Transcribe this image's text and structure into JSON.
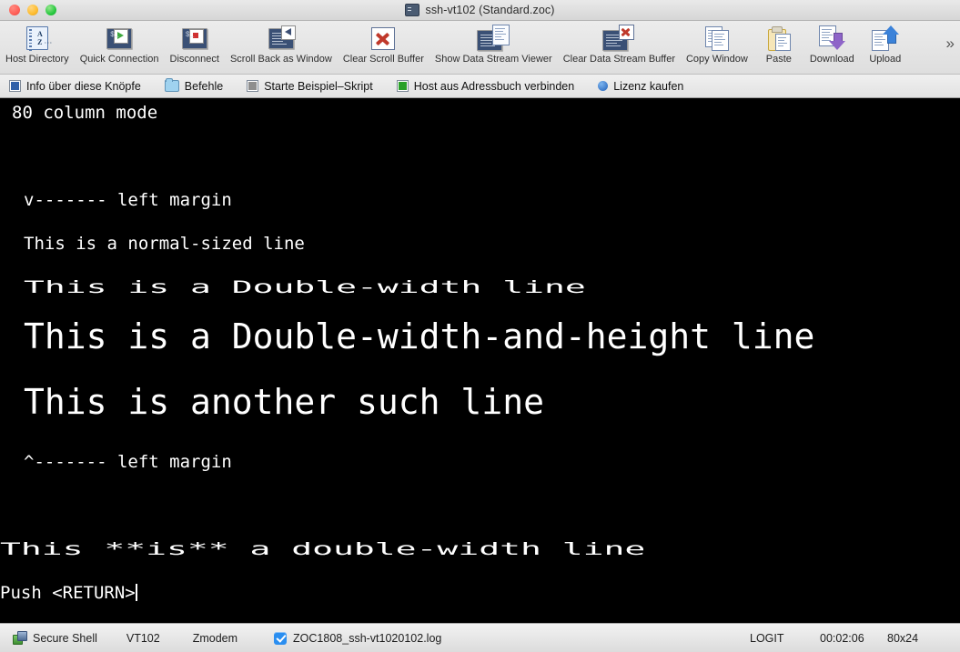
{
  "window": {
    "title": "ssh-vt102 (Standard.zoc)",
    "title_icon": "terminal-icon",
    "traffic_lights": [
      "close",
      "minimize",
      "zoom"
    ]
  },
  "toolbar": {
    "items": [
      {
        "label": "Host Directory",
        "icon": "address-book-icon"
      },
      {
        "label": "Quick Connection",
        "icon": "terminal-play-icon"
      },
      {
        "label": "Disconnect",
        "icon": "terminal-stop-icon"
      },
      {
        "label": "Scroll Back as Window",
        "icon": "scrollback-window-icon"
      },
      {
        "label": "Clear Scroll Buffer",
        "icon": "red-x-icon"
      },
      {
        "label": "Show Data Stream Viewer",
        "icon": "data-stream-viewer-icon"
      },
      {
        "label": "Clear Data Stream Buffer",
        "icon": "data-stream-clear-icon"
      },
      {
        "label": "Copy Window",
        "icon": "copy-documents-icon"
      },
      {
        "label": "Paste",
        "icon": "clipboard-paste-icon"
      },
      {
        "label": "Download",
        "icon": "download-arrow-icon"
      },
      {
        "label": "Upload",
        "icon": "upload-arrow-icon"
      }
    ],
    "overflow_label": "»"
  },
  "bookmark_bar": {
    "items": [
      {
        "label": "Info über diese Knöpfe",
        "icon": "blue-square-icon"
      },
      {
        "label": "Befehle",
        "icon": "folder-icon"
      },
      {
        "label": "Starte Beispiel–Skript",
        "icon": "gray-square-icon"
      },
      {
        "label": "Host aus Adressbuch verbinden",
        "icon": "green-square-icon"
      },
      {
        "label": "Lizenz kaufen",
        "icon": "blue-circle-icon"
      }
    ]
  },
  "terminal": {
    "background": "#000000",
    "foreground": "#ffffff",
    "lines": [
      {
        "text": "80 column mode",
        "mode": "normal",
        "indent": 1
      },
      {
        "text": "",
        "mode": "normal",
        "indent": 0
      },
      {
        "text": "",
        "mode": "normal",
        "indent": 0
      },
      {
        "text": "v------- left margin",
        "mode": "normal",
        "indent": 2
      },
      {
        "text": "This is a normal-sized line",
        "mode": "normal",
        "indent": 2
      },
      {
        "text": "This is a Double-width line",
        "mode": "double-width",
        "indent": 1
      },
      {
        "text": "This is a Double-width-and-height line",
        "mode": "double-width-and-height",
        "indent": 1
      },
      {
        "text": "This is another such line",
        "mode": "double-width-and-height",
        "indent": 1
      },
      {
        "text": "^------- left margin",
        "mode": "normal",
        "indent": 2
      },
      {
        "text": "",
        "mode": "normal",
        "indent": 0
      },
      {
        "text": "",
        "mode": "normal",
        "indent": 0
      },
      {
        "text": "This **is** a double-width line",
        "mode": "double-width",
        "indent": 0
      },
      {
        "text": "Push <RETURN>",
        "mode": "normal",
        "indent": 0,
        "cursor": true
      }
    ]
  },
  "status_bar": {
    "connection": "Secure Shell",
    "connection_icon": "network-icon",
    "emulation": "VT102",
    "transfer": "Zmodem",
    "log_enabled": true,
    "log_file": "ZOC1808_ssh-vt1020102.log",
    "logit": "LOGIT",
    "elapsed": "00:02:06",
    "dimensions": "80x24"
  }
}
